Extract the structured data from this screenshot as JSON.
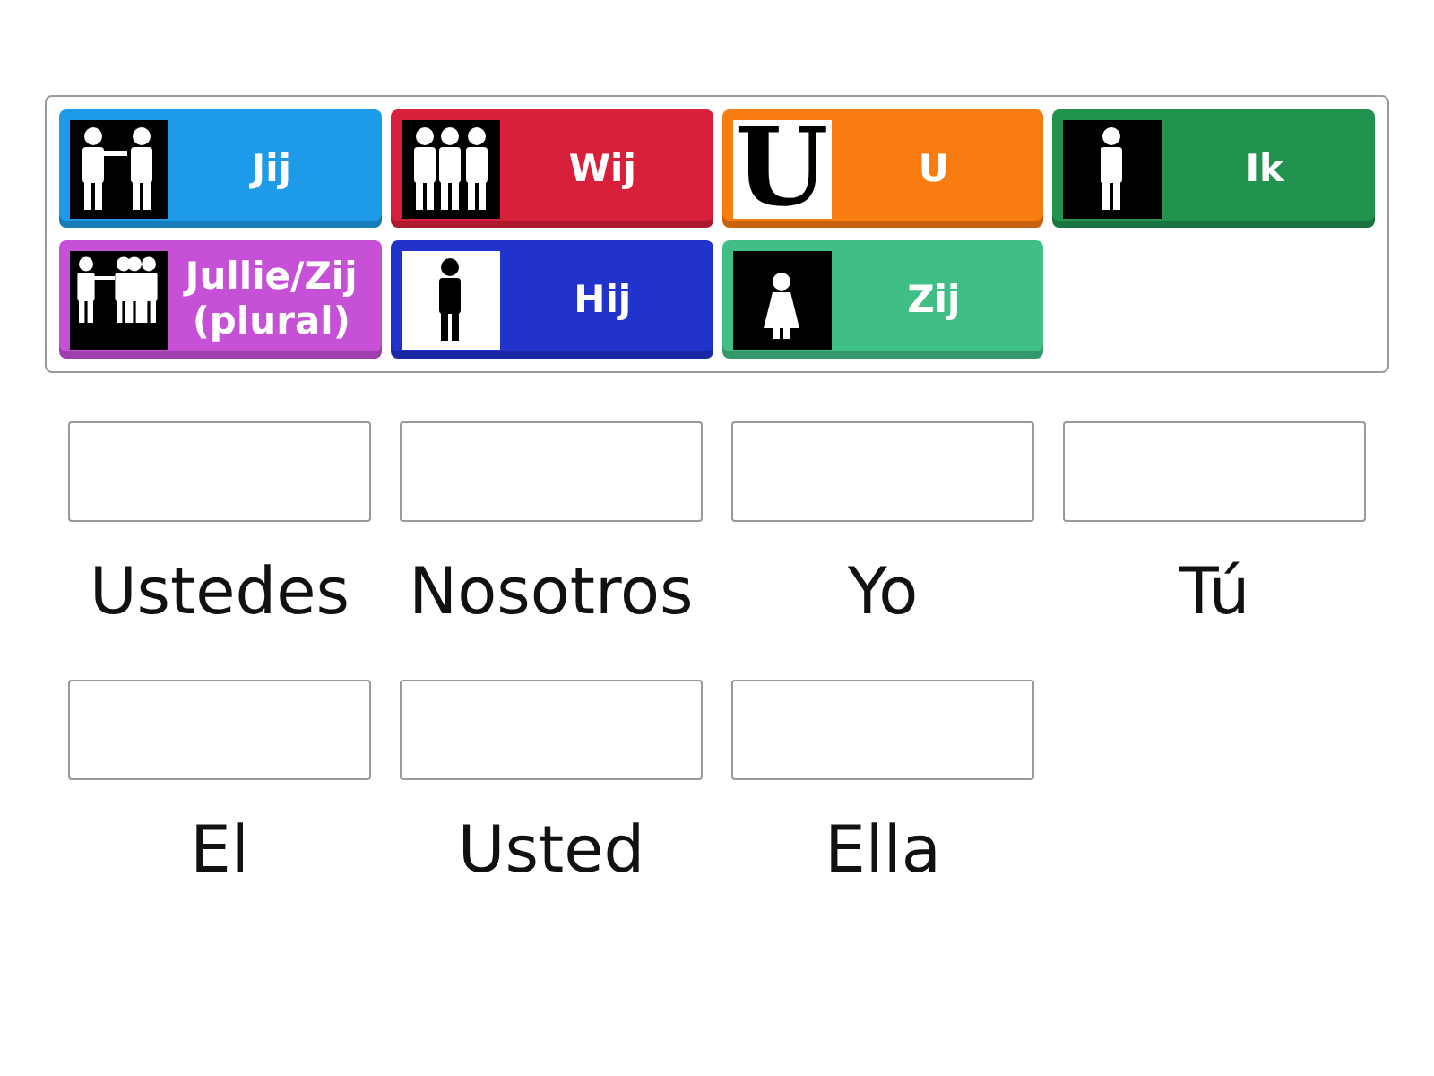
{
  "tiles": [
    {
      "label": "Jij",
      "color": "#1e9be8",
      "icon": {
        "kind": "pointing-pair"
      }
    },
    {
      "label": "Wij",
      "color": "#d9203a",
      "icon": {
        "kind": "group"
      }
    },
    {
      "label": "U",
      "color": "#f97c10",
      "icon": {
        "kind": "letter",
        "glyph": "U"
      }
    },
    {
      "label": "Ik",
      "color": "#22924f",
      "icon": {
        "kind": "signer"
      }
    },
    {
      "label": "Jullie/Zij (plural)",
      "color": "#c651d6",
      "icon": {
        "kind": "pointing-group"
      }
    },
    {
      "label": "Hij",
      "color": "#2233cc",
      "icon": {
        "kind": "man"
      }
    },
    {
      "label": "Zij",
      "color": "#3fbf85",
      "icon": {
        "kind": "girl"
      }
    }
  ],
  "targets": [
    {
      "label": "Ustedes"
    },
    {
      "label": "Nosotros"
    },
    {
      "label": "Yo"
    },
    {
      "label": "Tú"
    },
    {
      "label": "El"
    },
    {
      "label": "Usted"
    },
    {
      "label": "Ella"
    }
  ]
}
